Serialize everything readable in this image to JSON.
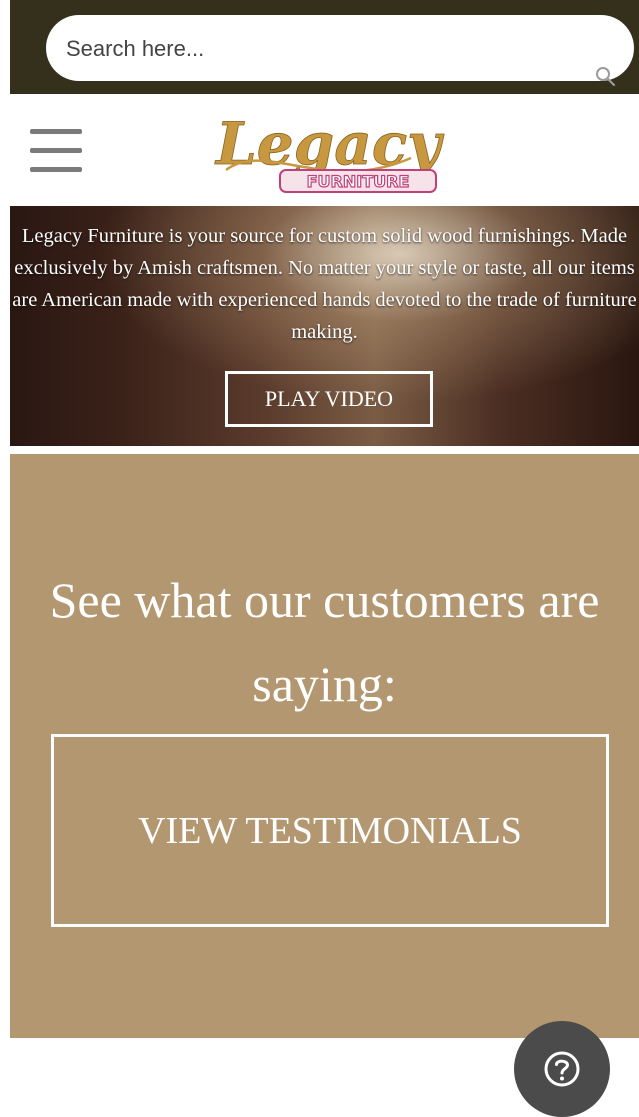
{
  "search": {
    "placeholder": "Search here...",
    "value": ""
  },
  "logo": {
    "script_text": "Legacy",
    "sub_text": "FURNITURE"
  },
  "hero": {
    "description": "Legacy Furniture is your source for custom solid wood furnishings. Made exclusively by Amish craftsmen. No matter your style or taste, all our items are American made with experienced hands devoted to the trade of furniture making.",
    "play_video_label": "PLAY VIDEO"
  },
  "testimonials": {
    "heading": "See what our customers are saying:",
    "button_label": "VIEW TESTIMONIALS"
  },
  "icons": {
    "search": "search-icon",
    "menu": "hamburger-menu-icon",
    "help": "question-mark-icon"
  },
  "colors": {
    "top_bar": "#34301c",
    "testimonials_bg": "#b39770",
    "logo_gold": "#c7983f",
    "logo_pink": "#c0407a",
    "help_button": "#4b4b4b"
  }
}
